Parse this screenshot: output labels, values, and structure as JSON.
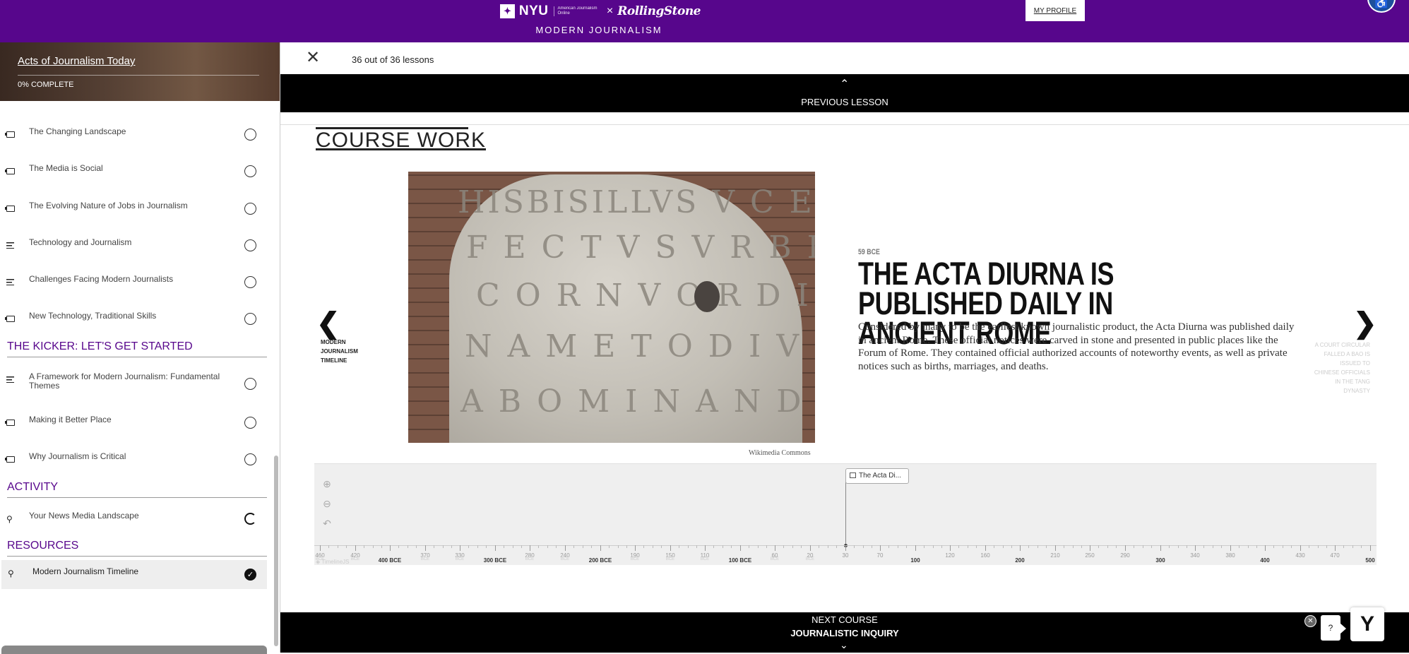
{
  "banner": {
    "nyu": "NYU",
    "partner_line": "American Journalism Online",
    "times": "×",
    "rolling_stone": "RollingStone",
    "program": "MODERN JOURNALISM",
    "my_profile": "MY PROFILE"
  },
  "sidebar": {
    "course_title": "Acts of Journalism Today",
    "progress": "0% COMPLETE",
    "lessons_a": [
      {
        "label": "The Changing Landscape",
        "icon": "video-icon"
      },
      {
        "label": "The Media is Social",
        "icon": "video-icon"
      },
      {
        "label": "The Evolving Nature of Jobs in Journalism",
        "icon": "video-icon"
      },
      {
        "label": "Technology and Journalism",
        "icon": "text-icon"
      },
      {
        "label": "Challenges Facing Modern Journalists",
        "icon": "text-icon"
      },
      {
        "label": "New Technology, Traditional Skills",
        "icon": "video-icon"
      }
    ],
    "section_kicker": "THE KICKER: LET'S GET STARTED",
    "lessons_b": [
      {
        "label": "A Framework for Modern Journalism: Fundamental Themes",
        "icon": "text-icon"
      },
      {
        "label": "Making it Better Place",
        "icon": "video-icon"
      },
      {
        "label": "Why Journalism is Critical",
        "icon": "video-icon"
      }
    ],
    "section_activity": "ACTIVITY",
    "activity": {
      "label": "Your News Media Landscape",
      "icon": "activity-icon"
    },
    "section_resources": "RESOURCES",
    "resource": {
      "label": "Modern Journalism Timeline",
      "icon": "activity-icon"
    }
  },
  "header": {
    "close_glyph": "✕",
    "counter": "36 out of 36 lessons"
  },
  "prev_lesson": {
    "chevron": "⌃",
    "label": "PREVIOUS LESSON"
  },
  "content": {
    "heading": "COURSE WORK",
    "slide": {
      "date": "59 BCE",
      "title": "THE ACTA DIURNA IS PUBLISHED DAILY IN ANCIENT ROME",
      "text": "Considered by many to be the earliest known journalistic product, the Acta Diurna was published daily in ancient Rome. These official notices were carved in stone and presented in public places like the Forum of Rome. They contained official authorized accounts of noteworthy events, as well as private notices such as births, marriages, and deaths.",
      "credit": "Wikimedia Commons",
      "inscription": [
        "HISBISILLVS V C E TINIR",
        "F E C T V S V R B I A T R I C I V S",
        "C O R N V O R D I N A R I S A R",
        "N A M E T O D I V M Q V A E",
        "A B O M I N A N D I S"
      ]
    },
    "nav_prev": {
      "arrow": "❮",
      "label": "MODERN JOURNALISM TIMELINE"
    },
    "nav_next": {
      "arrow": "❯",
      "label": "A COURT CIRCULAR FALLED A BAO IS ISSUED TO CHINESE OFFICIALS IN THE TANG DYNASTY"
    }
  },
  "timeline_nav": {
    "zoom_in": "⊕",
    "zoom_out": "⊖",
    "back": "↶",
    "marker_label": "The Acta Di...",
    "credit": "◈ TimelineJS",
    "ticks": [
      {
        "label": "460",
        "sub": "BCE"
      },
      {
        "label": "420",
        "sub": "BCE"
      },
      {
        "label": "400 BCE",
        "major": true
      },
      {
        "label": "370",
        "sub": "BCE"
      },
      {
        "label": "330",
        "sub": "BCE"
      },
      {
        "label": "300 BCE",
        "major": true
      },
      {
        "label": "280",
        "sub": "BCE"
      },
      {
        "label": "240",
        "sub": "BCE"
      },
      {
        "label": "200 BCE",
        "major": true
      },
      {
        "label": "190",
        "sub": "BCE"
      },
      {
        "label": "150",
        "sub": "BCE"
      },
      {
        "label": "110",
        "sub": "BCE"
      },
      {
        "label": "100 BCE",
        "major": true
      },
      {
        "label": "60",
        "sub": "BCE"
      },
      {
        "label": "20",
        "sub": "BCE"
      },
      {
        "label": "30"
      },
      {
        "label": "70"
      },
      {
        "label": "100",
        "major": true
      },
      {
        "label": "120"
      },
      {
        "label": "160"
      },
      {
        "label": "200",
        "major": true
      },
      {
        "label": "210"
      },
      {
        "label": "250"
      },
      {
        "label": "290"
      },
      {
        "label": "300",
        "major": true
      },
      {
        "label": "340"
      },
      {
        "label": "380"
      },
      {
        "label": "400",
        "major": true
      },
      {
        "label": "430"
      },
      {
        "label": "470"
      },
      {
        "label": "500",
        "major": true
      }
    ]
  },
  "next_course": {
    "line1": "NEXT COURSE",
    "line2": "JOURNALISTIC INQUIRY",
    "chevron": "⌄"
  },
  "help": {
    "close": "✕",
    "question": "?",
    "yellowdig": "Y"
  },
  "colors": {
    "brand_purple": "#57068c",
    "black_bar": "#000000",
    "timeline_bg": "#efefef"
  }
}
